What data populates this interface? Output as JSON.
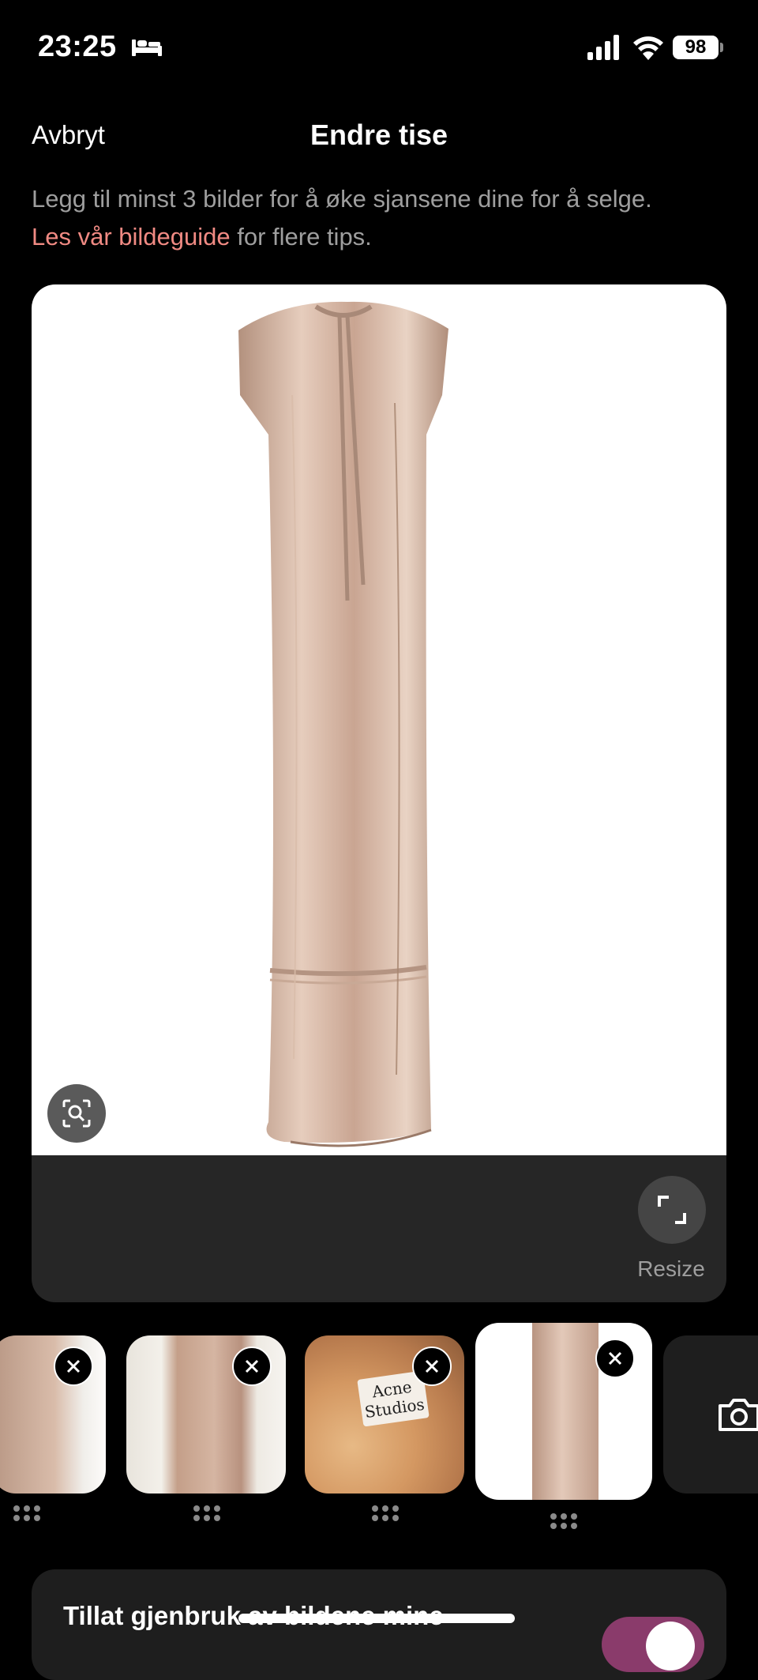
{
  "status_bar": {
    "time": "23:25",
    "battery": "98"
  },
  "nav": {
    "cancel_label": "Avbryt",
    "title": "Endre tise"
  },
  "hint": {
    "text_before": "Legg til minst 3 bilder for å øke sjansene dine for å selge.",
    "link_text": "Les vår bildeguide",
    "text_after": " for flere tips."
  },
  "photo_editor": {
    "resize_label": "Resize"
  },
  "thumbnails": [
    {
      "label": "Acne Studios"
    }
  ],
  "settings": {
    "reuse_images_label": "Tillat gjenbruk av bildene mine"
  },
  "colors": {
    "accent_link": "#f08a83",
    "toggle_on": "#8a3b6b",
    "background": "#000000"
  }
}
